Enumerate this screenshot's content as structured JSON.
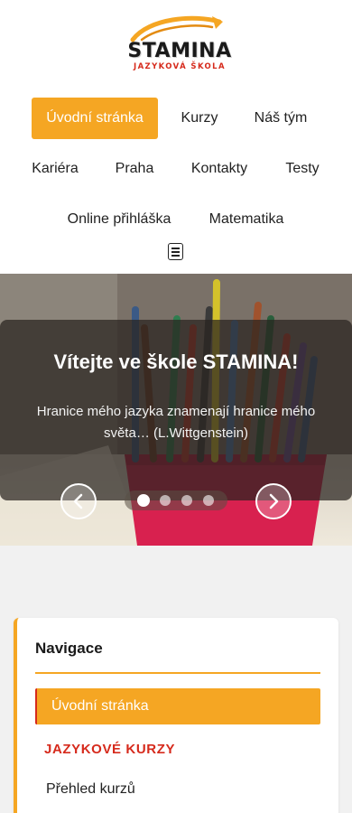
{
  "logo": {
    "brand": "STAMINA",
    "subtitle": "JAZYKOVÁ ŠKOLA"
  },
  "nav": {
    "items": [
      {
        "label": "Úvodní stránka",
        "active": true
      },
      {
        "label": "Kurzy"
      },
      {
        "label": "Náš tým"
      },
      {
        "label": "Kariéra"
      },
      {
        "label": "Praha"
      },
      {
        "label": "Kontakty"
      },
      {
        "label": "Testy"
      },
      {
        "label": "Online přihláška"
      },
      {
        "label": "Matematika"
      }
    ],
    "menu_icon": "hamburger-icon"
  },
  "slider": {
    "title": "Vítejte ve škole STAMINA!",
    "text": "Hranice mého jazyka znamenají hranice mého světa… (L.Wittgenstein)",
    "slide_count": 4,
    "active_slide": 1,
    "prev_icon": "chevron-left-icon",
    "next_icon": "chevron-right-icon"
  },
  "sidebar": {
    "title": "Navigace",
    "active_item": "Úvodní stránka",
    "section_heading": "JAZYKOVÉ KURZY",
    "items": [
      "Přehled kurzů"
    ]
  },
  "colors": {
    "accent": "#f5a623",
    "brand_red": "#d62a1c",
    "text": "#222222",
    "page_bg": "#f1f1f1"
  }
}
